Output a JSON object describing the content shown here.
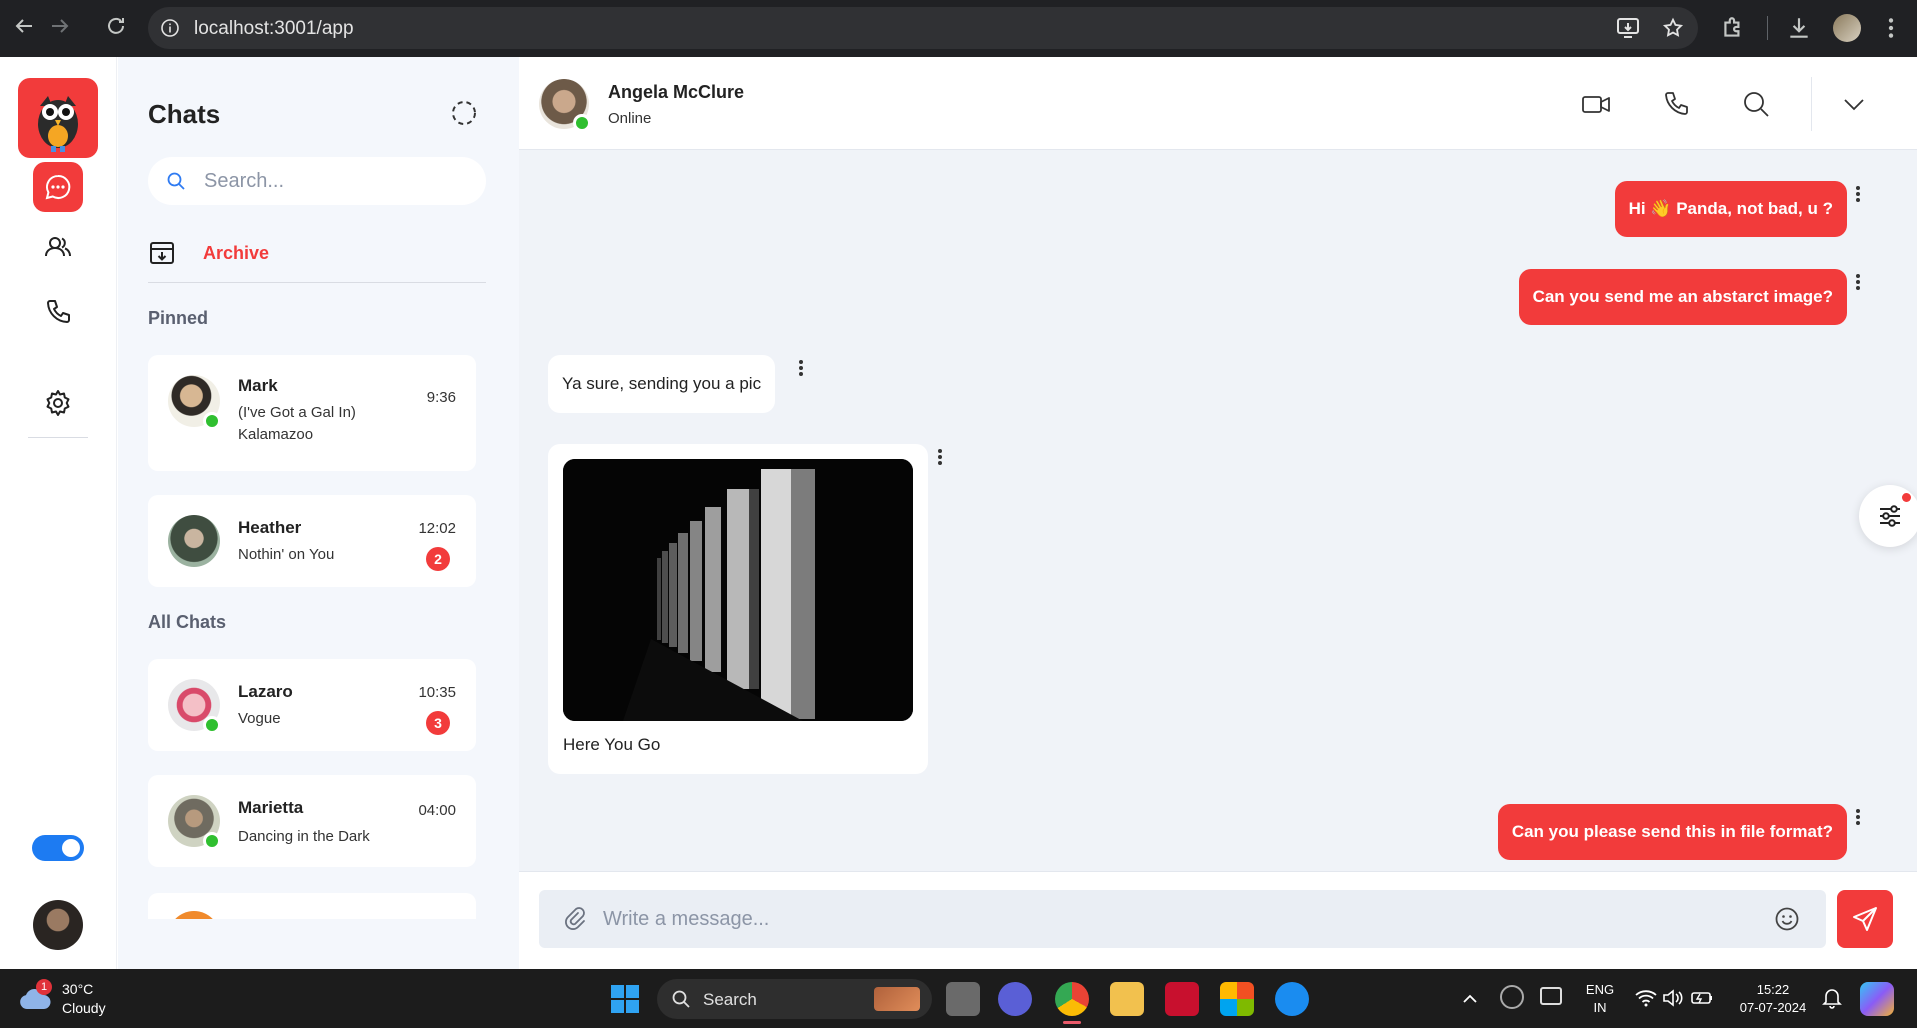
{
  "browser": {
    "url": "localhost:3001/app"
  },
  "sidebar": {
    "logo_icon": "owl-logo-icon",
    "items": [
      {
        "icon": "chat-bubble-icon",
        "active": true
      },
      {
        "icon": "users-icon",
        "active": false
      },
      {
        "icon": "phone-icon",
        "active": false
      },
      {
        "icon": "gear-icon",
        "active": false
      }
    ],
    "theme_toggle_on": true
  },
  "chats": {
    "title": "Chats",
    "search_placeholder": "Search...",
    "archive_label": "Archive",
    "pinned_label": "Pinned",
    "all_chats_label": "All Chats",
    "pinned": [
      {
        "name": "Mark",
        "message": "(I've Got a Gal In) Kalamazoo",
        "time": "9:36",
        "online": true,
        "unread": ""
      },
      {
        "name": "Heather",
        "message": "Nothin' on You",
        "time": "12:02",
        "online": false,
        "unread": "2"
      }
    ],
    "all": [
      {
        "name": "Lazaro",
        "message": "Vogue",
        "time": "10:35",
        "online": true,
        "unread": "3"
      },
      {
        "name": "Marietta",
        "message": "Dancing in the Dark",
        "time": "04:00",
        "online": true,
        "unread": ""
      }
    ]
  },
  "conversation": {
    "contact_name": "Angela McClure",
    "contact_status": "Online",
    "messages": [
      {
        "direction": "outgoing",
        "text": "Hi 👋 Panda, not bad, u ?"
      },
      {
        "direction": "outgoing",
        "text": "Can you send me an abstarct image?"
      },
      {
        "direction": "incoming",
        "text": "Ya sure, sending you a pic"
      },
      {
        "direction": "incoming",
        "type": "image",
        "caption": "Here You Go"
      },
      {
        "direction": "outgoing",
        "text": "Can you please send this in file format?"
      }
    ],
    "composer_placeholder": "Write a message..."
  },
  "taskbar": {
    "weather_temp": "30°C",
    "weather_desc": "Cloudy",
    "weather_badge": "1",
    "search_label": "Search",
    "lang_line1": "ENG",
    "lang_line2": "IN",
    "time": "15:22",
    "date": "07-07-2024"
  },
  "colors": {
    "accent": "#f23b3b",
    "online": "#2fbf2f",
    "toggle": "#1d7bf2"
  }
}
